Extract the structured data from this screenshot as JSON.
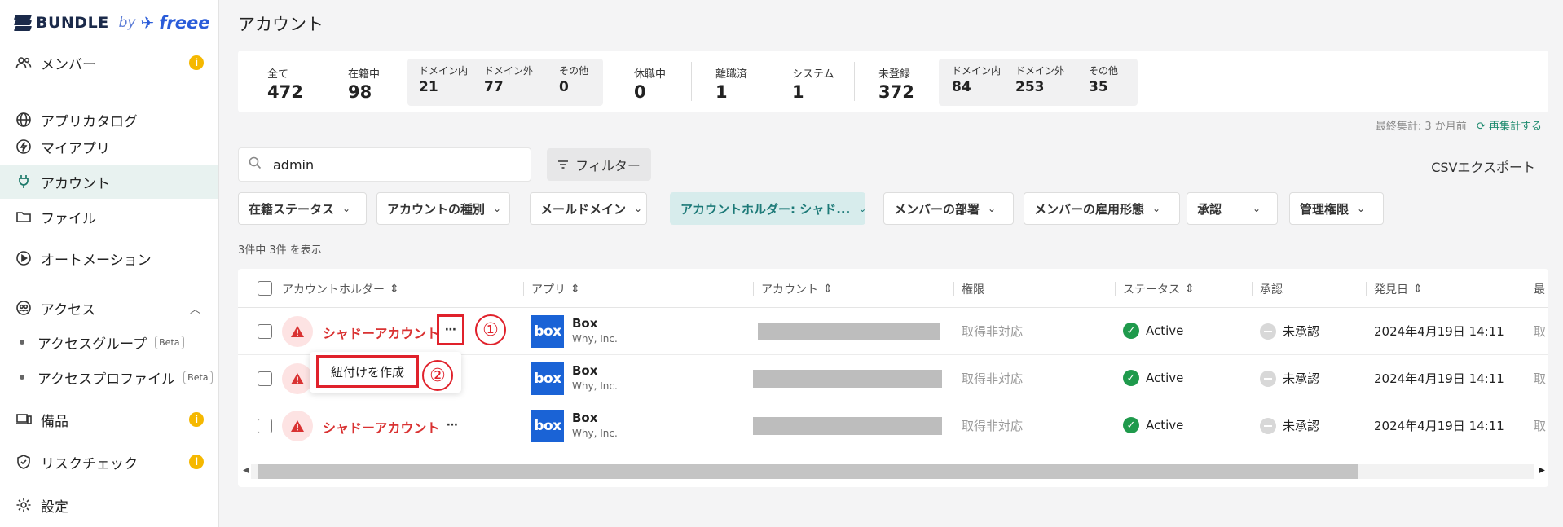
{
  "brand": {
    "name": "BUNDLE",
    "by": "by",
    "partner": "freee"
  },
  "sidebar": {
    "items": [
      {
        "label": "メンバー",
        "badge": "i"
      },
      {
        "label": "アプリカタログ"
      },
      {
        "label": "マイアプリ"
      },
      {
        "label": "アカウント"
      },
      {
        "label": "ファイル"
      },
      {
        "label": "オートメーション"
      },
      {
        "label": "アクセス"
      },
      {
        "label": "備品",
        "badge": "i"
      },
      {
        "label": "リスクチェック",
        "badge": "i"
      },
      {
        "label": "設定"
      }
    ],
    "sub_items": [
      {
        "label": "アクセスグループ",
        "badge": "Beta"
      },
      {
        "label": "アクセスプロファイル",
        "badge": "Beta"
      }
    ]
  },
  "page": {
    "title": "アカウント"
  },
  "stats": {
    "all": {
      "label": "全て",
      "value": "472"
    },
    "enrolled": {
      "label": "在籍中",
      "value": "98"
    },
    "enrolled_sub": [
      {
        "label": "ドメイン内",
        "value": "21"
      },
      {
        "label": "ドメイン外",
        "value": "77"
      },
      {
        "label": "その他",
        "value": "0"
      }
    ],
    "on_leave": {
      "label": "休職中",
      "value": "0"
    },
    "left": {
      "label": "離職済",
      "value": "1"
    },
    "system": {
      "label": "システム",
      "value": "1"
    },
    "unregistered": {
      "label": "未登録",
      "value": "372"
    },
    "unregistered_sub": [
      {
        "label": "ドメイン内",
        "value": "84"
      },
      {
        "label": "ドメイン外",
        "value": "253"
      },
      {
        "label": "その他",
        "value": "35"
      }
    ]
  },
  "recalc": {
    "last": "最終集計: 3 か月前",
    "link": "再集計する"
  },
  "search": {
    "value": "admin"
  },
  "filter_button": "フィルター",
  "csv_export": "CSVエクスポート",
  "chips": [
    {
      "label": "在籍ステータス"
    },
    {
      "label": "アカウントの種別"
    },
    {
      "label": "メールドメイン"
    },
    {
      "label": "アカウントホルダー: シャド..."
    },
    {
      "label": "メンバーの部署"
    },
    {
      "label": "メンバーの雇用形態"
    },
    {
      "label": "承認"
    },
    {
      "label": "管理権限"
    }
  ],
  "result_count": "3件中 3件 を表示",
  "table": {
    "columns": [
      "アカウントホルダー",
      "アプリ",
      "アカウント",
      "権限",
      "ステータス",
      "承認",
      "発見日",
      "最"
    ],
    "rows": [
      {
        "holder": "シャドーアカウント",
        "app": "Box",
        "app_logo": "box",
        "company": "Why, Inc.",
        "permission": "取得非対応",
        "status": "Active",
        "approval": "未承認",
        "date": "2024年4月19日 14:11",
        "last": "取"
      },
      {
        "holder": "",
        "app": "Box",
        "app_logo": "box",
        "company": "Why, Inc.",
        "permission": "取得非対応",
        "status": "Active",
        "approval": "未承認",
        "date": "2024年4月19日 14:11",
        "last": "取"
      },
      {
        "holder": "シャドーアカウント",
        "app": "Box",
        "app_logo": "box",
        "company": "Why, Inc.",
        "permission": "取得非対応",
        "status": "Active",
        "approval": "未承認",
        "date": "2024年4月19日 14:11",
        "last": "取"
      }
    ]
  },
  "popover": {
    "item": "紐付けを作成"
  },
  "annotations": [
    "①",
    "②"
  ],
  "colors": {
    "accent": "#1d8a6e",
    "danger": "#d93232",
    "highlight": "#e0212b",
    "active_nav": "#e8f2f0",
    "box_blue": "#1a63d6"
  }
}
